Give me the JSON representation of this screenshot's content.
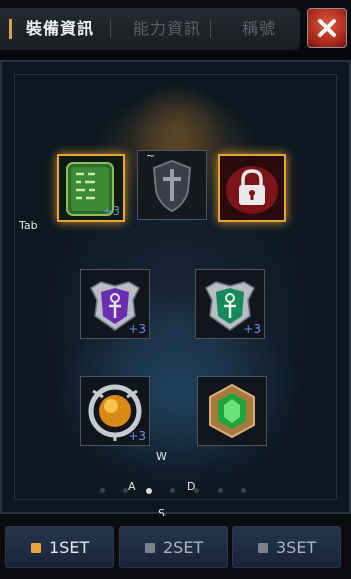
{
  "tabs": [
    {
      "label": "裝備資訊",
      "active": true
    },
    {
      "label": "能力資訊",
      "active": false
    },
    {
      "label": "稱號",
      "active": false
    }
  ],
  "slots": {
    "tome": {
      "enhance": "+3"
    },
    "shield": {
      "enhance": ""
    },
    "locked": {
      "enhance": ""
    },
    "purple_ankh": {
      "enhance": "+3"
    },
    "green_ankh": {
      "enhance": "+3"
    },
    "gold_orb": {
      "enhance": "+3"
    },
    "emerald": {
      "enhance": ""
    }
  },
  "key_labels": {
    "tab": "Tab",
    "tilde": "~",
    "w": "W",
    "a": "A",
    "d": "D",
    "s": "S"
  },
  "page_dots": {
    "count": 7,
    "active_index": 2
  },
  "set_buttons": [
    {
      "label": "1SET",
      "active": true
    },
    {
      "label": "2SET",
      "active": false
    },
    {
      "label": "3SET",
      "active": false
    }
  ],
  "colors": {
    "accent_gold": "#e6a531",
    "enhance_blue": "#5f8fe8",
    "close_red": "#c23a22"
  },
  "icons": {
    "close": "close-icon",
    "tome": "tome-icon",
    "shield": "cross-shield-icon",
    "lock": "lock-icon",
    "purple_ankh": "purple-ankh-crest-icon",
    "green_ankh": "green-ankh-crest-icon",
    "gold_orb": "gold-orb-icon",
    "emerald": "emerald-gem-icon"
  }
}
